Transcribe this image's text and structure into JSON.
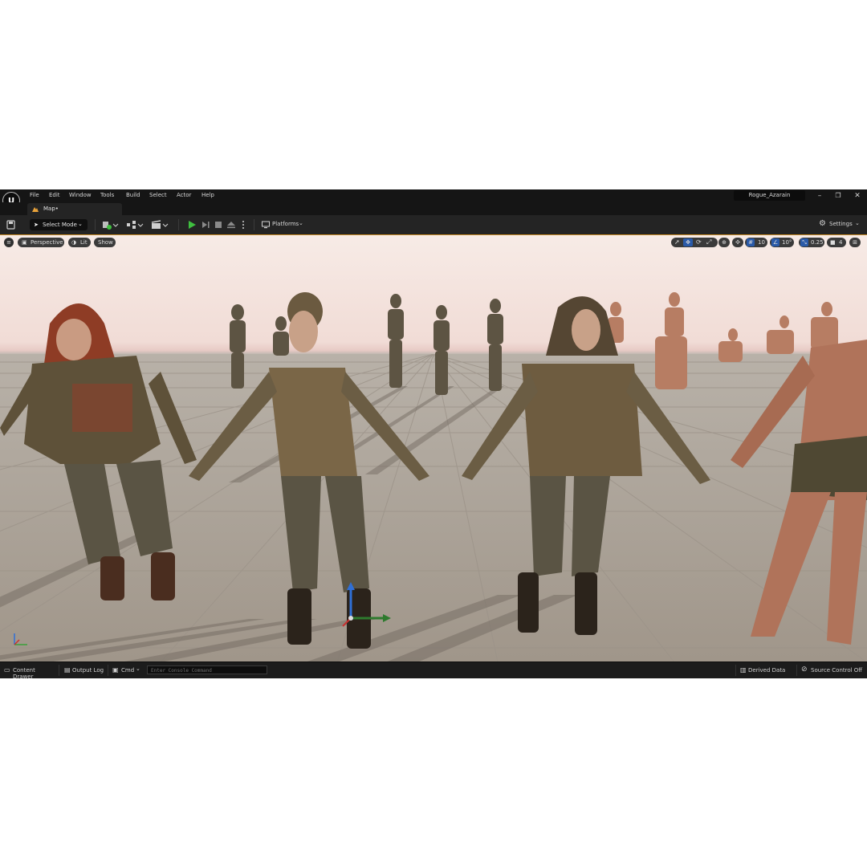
{
  "menu": {
    "logo_icon": "unreal-logo-icon",
    "items": [
      "File",
      "Edit",
      "Window",
      "Tools",
      "Build",
      "Select",
      "Actor",
      "Help"
    ]
  },
  "window": {
    "project_name": "Rogue_Azarain",
    "minimize_glyph": "–",
    "restore_glyph": "❐",
    "close_glyph": "✕"
  },
  "tabs": [
    {
      "label": "Map•",
      "icon": "level-map-icon",
      "icon_color": "#e8a23a"
    }
  ],
  "toolbar": {
    "save_icon": "save-icon",
    "select_mode_label": "Select Mode",
    "platforms_label": "Platforms",
    "settings_label": "Settings",
    "play_color": "#3fbf3f"
  },
  "viewport": {
    "perspective_label": "Perspective",
    "lit_label": "Lit",
    "show_label": "Show",
    "grid_snap_value": "10",
    "rotation_snap_value": "10°",
    "scale_snap_value": "0.25",
    "camera_speed_value": "4",
    "border_color": "#c98a23",
    "gizmo_colors": {
      "x": "#c8312f",
      "y": "#3aa03a",
      "z": "#2f6fd6"
    }
  },
  "statusbar": {
    "content_drawer_label": "Content Drawer",
    "output_log_label": "Output Log",
    "cmd_label": "Cmd",
    "console_placeholder": "Enter Console Command",
    "derived_data_label": "Derived Data",
    "source_control_label": "Source Control Off"
  }
}
